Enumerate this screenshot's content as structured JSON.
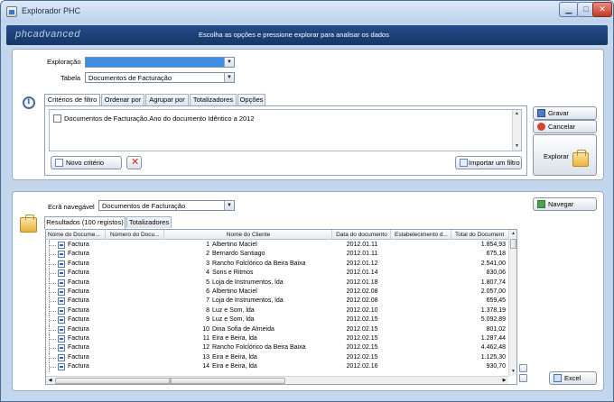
{
  "window": {
    "title": "Explorador PHC"
  },
  "banner": {
    "logo": "phcadvanced",
    "message": "Escolha as opções e pressione explorar para analisar os dados"
  },
  "top": {
    "exploracao_label": "Exploração",
    "exploracao_value": "",
    "tabela_label": "Tabela",
    "tabela_value": "Documentos de Facturação",
    "tabs": [
      "Critérios de filtro",
      "Ordenar por",
      "Agrupar por",
      "Totalizadores",
      "Opções"
    ],
    "filter_item": "Documentos de Facturação.Ano do documento Idêntico a 2012",
    "novo_criterio": "Novo critério",
    "importar_filtro": "Importar um filtro",
    "gravar": "Gravar",
    "cancelar": "Cancelar",
    "explorar": "Explorar"
  },
  "bottom": {
    "ecra_label": "Ecrã navegável",
    "ecra_value": "Documentos de Facturação",
    "navegar": "Navegar",
    "excel": "Excel",
    "tabs": [
      "Resultados (100 registos)",
      "Totalizadores"
    ],
    "columns": [
      "Nome do Docume...",
      "Número do Docu...",
      "Nome do Cliente",
      "Data do documento",
      "Estabelecimento d...",
      "Total do Document"
    ],
    "rows": [
      [
        "Factura",
        "1",
        "Albertino Maciel",
        "2012.01.11",
        "",
        "1.854,93"
      ],
      [
        "Factura",
        "2",
        "Bernardo Santiago",
        "2012.01.11",
        "",
        "675,18"
      ],
      [
        "Factura",
        "3",
        "Rancho Folclórico da Beira Baixa",
        "2012.01.12",
        "",
        "2.541,00"
      ],
      [
        "Factura",
        "4",
        "Sons e Ritmos",
        "2012.01.14",
        "",
        "830,06"
      ],
      [
        "Factura",
        "5",
        "Loja de Instrumentos, lda",
        "2012.01.18",
        "",
        "1.807,74"
      ],
      [
        "Factura",
        "6",
        "Albertino Maciel",
        "2012.02.08",
        "",
        "2.057,00"
      ],
      [
        "Factura",
        "7",
        "Loja de Instrumentos, lda",
        "2012.02.08",
        "",
        "659,45"
      ],
      [
        "Factura",
        "8",
        "Luz e Som, lda",
        "2012.02.10",
        "",
        "1.378,19"
      ],
      [
        "Factura",
        "9",
        "Luz e Som, lda",
        "2012.02.15",
        "",
        "5.092,89"
      ],
      [
        "Factura",
        "10",
        "Dina Sofia de Almeida",
        "2012.02.15",
        "",
        "801,02"
      ],
      [
        "Factura",
        "11",
        "Eira e Beira, lda",
        "2012.02.15",
        "",
        "1.287,44"
      ],
      [
        "Factura",
        "12",
        "Rancho Folclórico da Beira Baixa",
        "2012.02.15",
        "",
        "4.462,48"
      ],
      [
        "Factura",
        "13",
        "Eira e Beira, lda",
        "2012.02.15",
        "",
        "1.125,30"
      ],
      [
        "Factura",
        "14",
        "Eira e Beira, lda",
        "2012.02.16",
        "",
        "930,70"
      ]
    ]
  },
  "colors": {
    "banner": "#1d4479",
    "frame": "#c4d6ec",
    "selection": "#3d8ee5"
  }
}
